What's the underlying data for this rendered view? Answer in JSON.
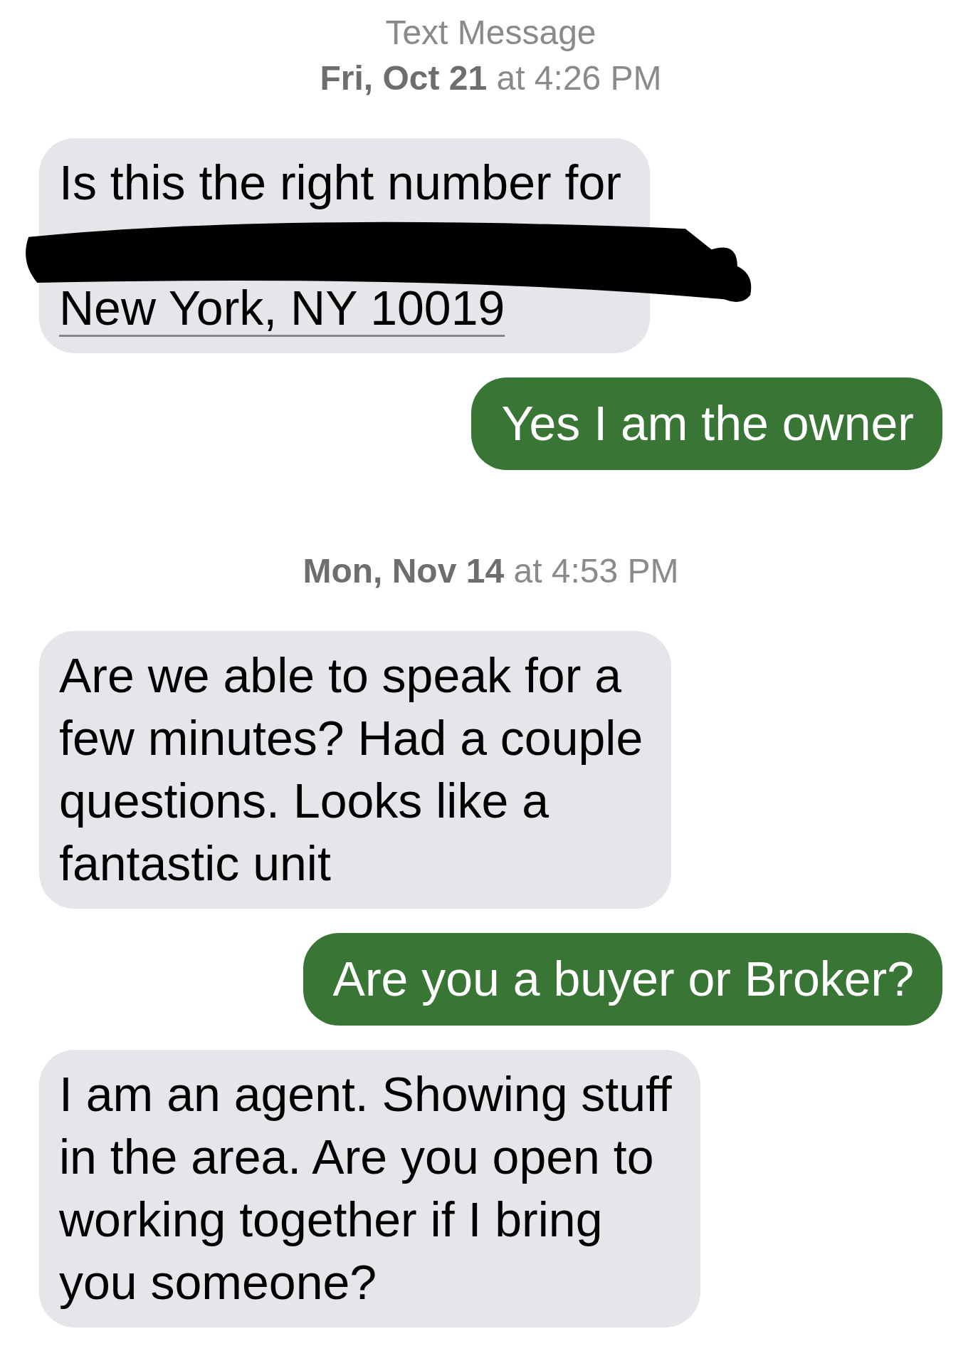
{
  "header": {
    "title": "Text Message",
    "timestamp": "**Fri, Oct 21** at 4:26 PM"
  },
  "messages": [
    {
      "kind": "received",
      "lines": [
        {
          "kind": "text",
          "text": "Is this the right number for"
        },
        {
          "kind": "redacted"
        },
        {
          "kind": "link",
          "text": "New York, NY 10019"
        }
      ]
    },
    {
      "kind": "sent",
      "lines": [
        {
          "kind": "text",
          "text": "Yes I am the owner"
        }
      ]
    },
    {
      "kind": "timestamp",
      "text": "**Mon, Nov 14** at 4:53 PM"
    },
    {
      "kind": "received",
      "lines": [
        {
          "kind": "text",
          "text": "Are we able to speak for a\nfew minutes? Had a couple\nquestions. Looks like a\nfantastic unit"
        }
      ]
    },
    {
      "kind": "sent",
      "lines": [
        {
          "kind": "text",
          "text": "Are you a buyer or Broker?"
        }
      ]
    },
    {
      "kind": "received",
      "lines": [
        {
          "kind": "text",
          "text": "I am an agent. Showing stuff\nin the area. Are you open to\nworking together if I bring\nyou someone?"
        }
      ]
    }
  ]
}
